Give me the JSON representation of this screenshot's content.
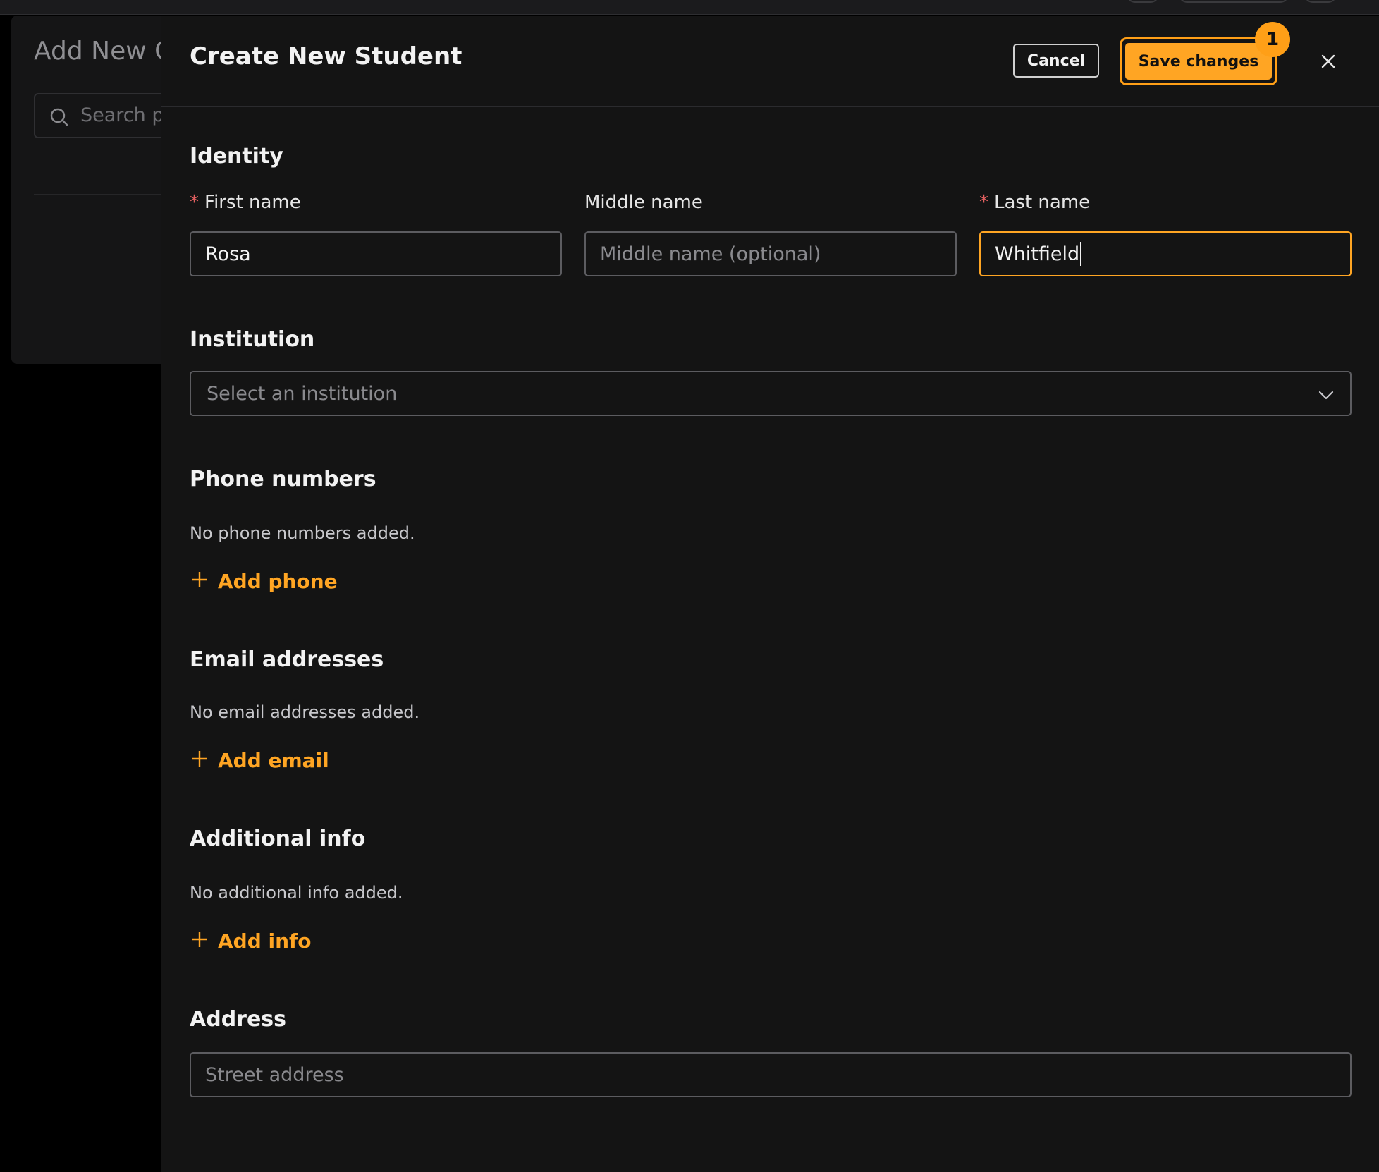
{
  "background": {
    "title": "Add New C",
    "search_placeholder": "Search p"
  },
  "drawer": {
    "title": "Create New Student",
    "cancel_label": "Cancel",
    "save_label": "Save changes",
    "save_badge": "1"
  },
  "identity": {
    "section_title": "Identity",
    "first_name": {
      "label": "First name",
      "required_marker": "*",
      "value": "Rosa"
    },
    "middle_name": {
      "label": "Middle name",
      "placeholder": "Middle name (optional)"
    },
    "last_name": {
      "label": "Last name",
      "required_marker": "*",
      "value": "Whitfield"
    }
  },
  "institution": {
    "section_title": "Institution",
    "placeholder": "Select an institution"
  },
  "phones": {
    "section_title": "Phone numbers",
    "empty_text": "No phone numbers added.",
    "add_label": "Add phone"
  },
  "emails": {
    "section_title": "Email addresses",
    "empty_text": "No email addresses added.",
    "add_label": "Add email"
  },
  "additional": {
    "section_title": "Additional info",
    "empty_text": "No additional info added.",
    "add_label": "Add info"
  },
  "address": {
    "section_title": "Address",
    "street_placeholder": "Street address"
  },
  "colors": {
    "accent": "#ffa523",
    "background": "#141414",
    "required": "#e25f5f"
  },
  "icons": [
    "search-icon",
    "close-icon",
    "chevron-down-icon",
    "plus-icon"
  ]
}
